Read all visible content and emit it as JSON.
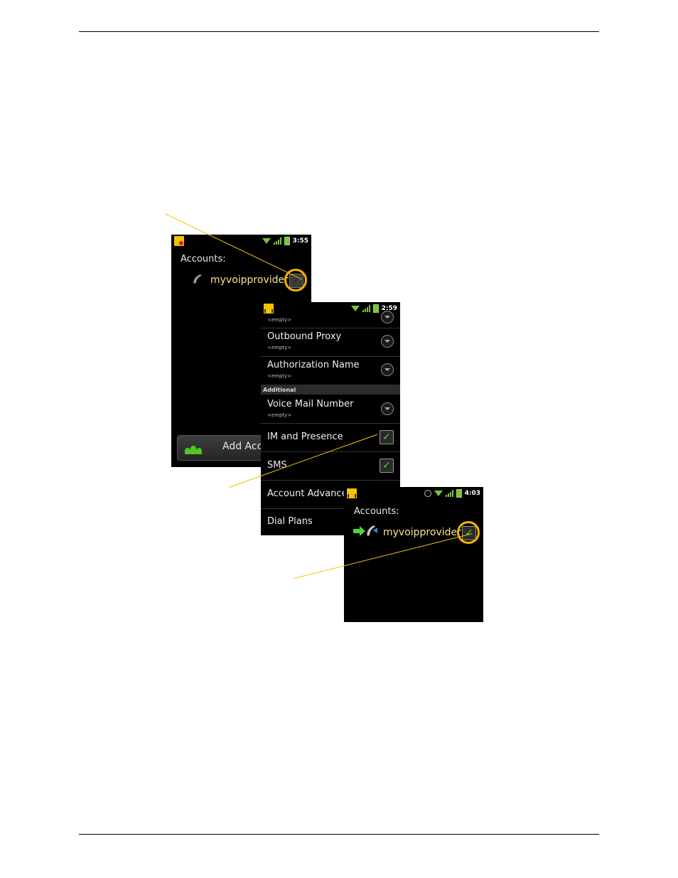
{
  "screen1": {
    "time": "3:55",
    "accounts_label": "Accounts:",
    "account_name": "myvoipprovider",
    "checkbox_checked": false,
    "add_button_label": "Add Account"
  },
  "screen2": {
    "time": "2:59",
    "rows": [
      {
        "title": "",
        "subtitle": "<empty>"
      },
      {
        "title": "Outbound Proxy",
        "subtitle": "<empty>"
      },
      {
        "title": "Authorization Name",
        "subtitle": "<empty>"
      }
    ],
    "section_header": "Additional",
    "voicemail": {
      "title": "Voice Mail Number",
      "subtitle": "<empty>"
    },
    "im_presence": {
      "title": "IM and Presence",
      "checked": true
    },
    "sms": {
      "title": "SMS",
      "checked": true
    },
    "account_advanced": {
      "title": "Account Advanced"
    },
    "dial_plans": {
      "title": "Dial Plans"
    }
  },
  "screen3": {
    "time": "4:03",
    "accounts_label": "Accounts:",
    "account_name": "myvoipprovider",
    "checkbox_checked": true
  },
  "colors": {
    "callout": "#f2c200",
    "check_green": "#52d33a",
    "account_text": "#f5e68a"
  }
}
